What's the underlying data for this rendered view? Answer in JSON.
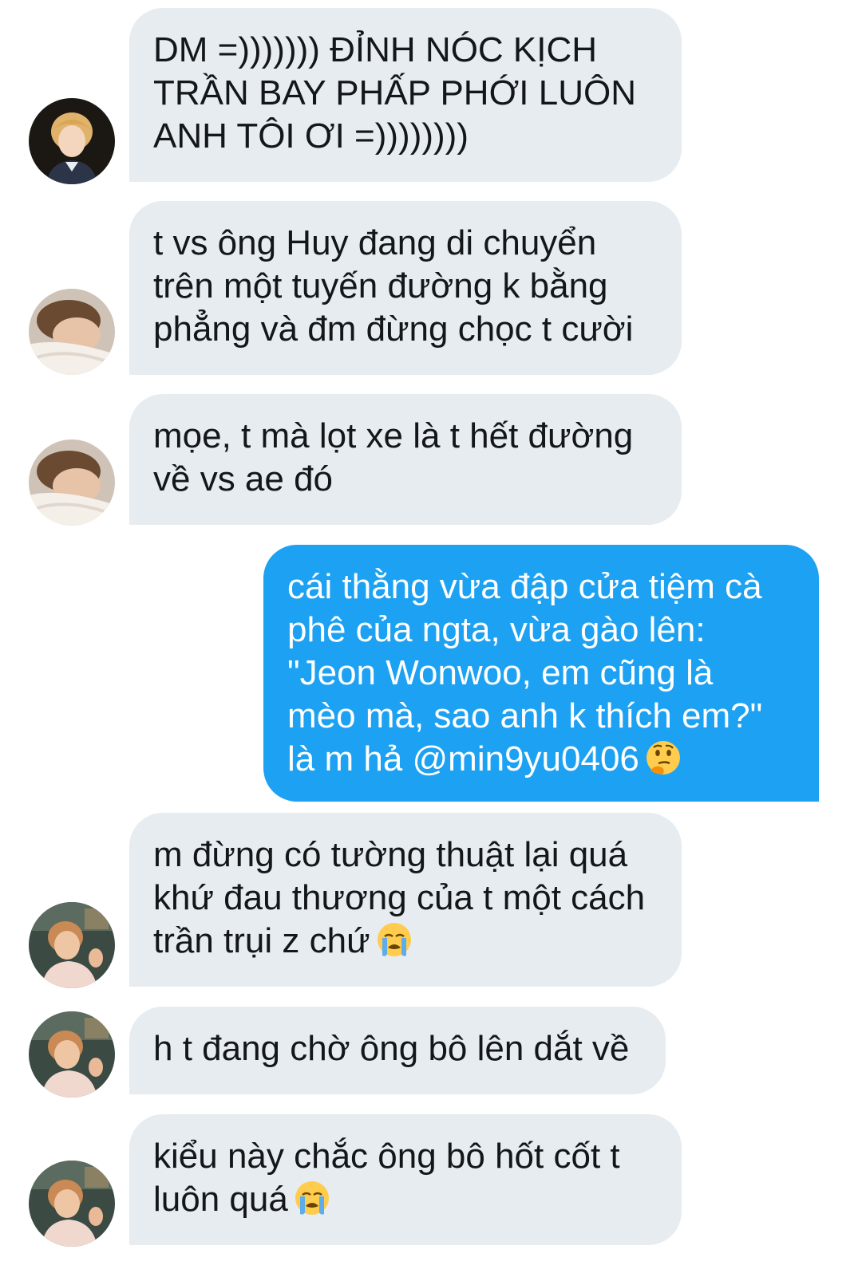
{
  "conversation": {
    "messages": [
      {
        "direction": "incoming",
        "avatar": "avatar-boy-blonde",
        "text": "DM =))))))) ĐỈNH NÓC KỊCH\nTRẦN BAY PHẤP PHỚI LUÔN\nANH TÔI ƠI =))))))))",
        "emoji": null
      },
      {
        "direction": "incoming",
        "avatar": "avatar-sleeping",
        "text": "t vs ông Huy đang di chuyển\ntrên một tuyến đường k bằng\nphẳng và đm đừng chọc t cười",
        "emoji": null
      },
      {
        "direction": "incoming",
        "avatar": "avatar-sleeping",
        "text": "mọe, t mà lọt xe là t hết đường\nvề vs ae đó",
        "emoji": null
      },
      {
        "direction": "outgoing",
        "avatar": null,
        "text": "cái thằng vừa đập cửa tiệm cà\nphê của ngta, vừa gào lên:\n\"Jeon Wonwoo, em cũng là\nmèo mà, sao anh k thích em?\"\nlà m hả @min9yu0406",
        "emoji": "thinking-face-emoji"
      },
      {
        "direction": "incoming",
        "avatar": "avatar-selfie",
        "text": "m đừng có tường thuật lại quá\nkhứ đau thương của t một cách\ntrần trụi z chứ",
        "emoji": "crying-face-emoji"
      },
      {
        "direction": "incoming",
        "avatar": "avatar-selfie",
        "text": "h t đang chờ ông bô lên dắt về",
        "emoji": null
      },
      {
        "direction": "incoming",
        "avatar": "avatar-selfie",
        "text": "kiểu này chắc ông bô hốt cốt t\nluôn quá",
        "emoji": "crying-face-emoji"
      }
    ]
  },
  "colors": {
    "incoming_bubble": "#e6ecf0",
    "outgoing_bubble": "#1da1f2",
    "incoming_text": "#14171a",
    "outgoing_text": "#ffffff"
  }
}
